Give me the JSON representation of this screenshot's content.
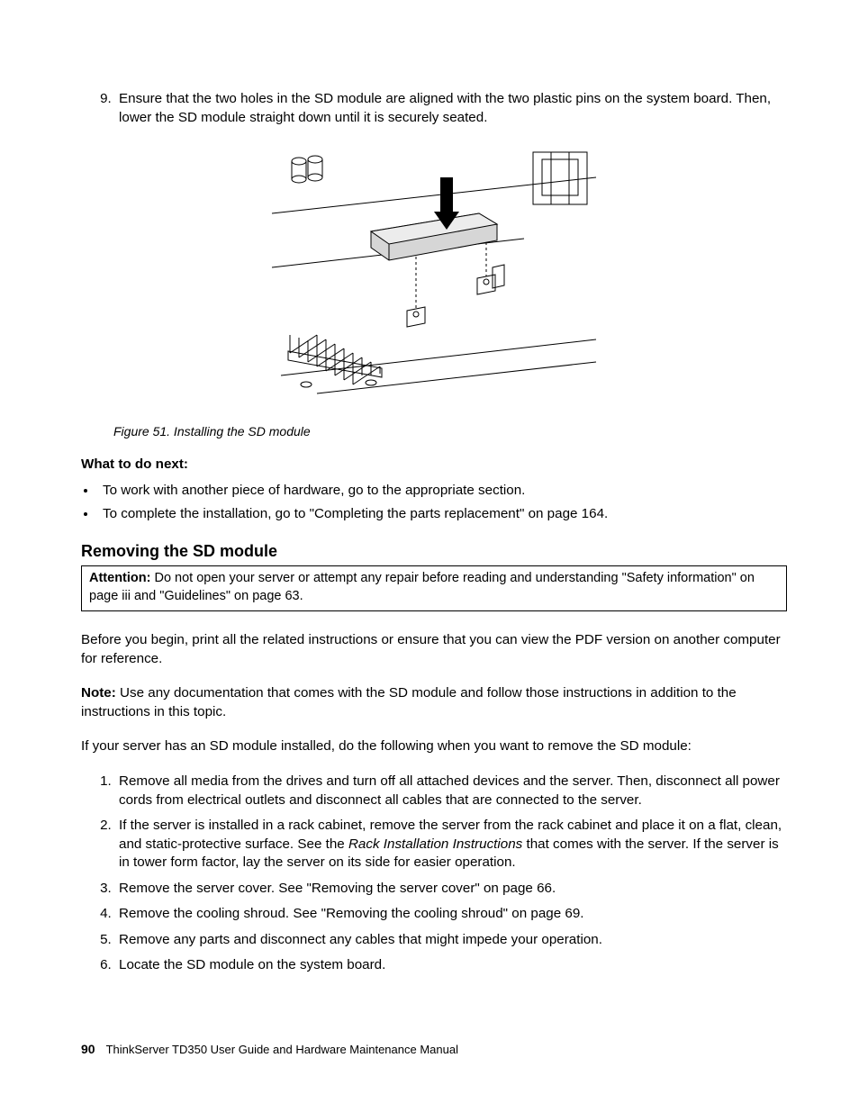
{
  "step9": {
    "number": "9.",
    "text": "Ensure that the two holes in the SD module are aligned with the two plastic pins on the system board. Then, lower the SD module straight down until it is securely seated."
  },
  "figure_caption": "Figure 51.  Installing the SD module",
  "what_next_heading": "What to do next:",
  "what_next_items": [
    "To work with another piece of hardware, go to the appropriate section.",
    "To complete the installation, go to \"Completing the parts replacement\" on page 164."
  ],
  "section_title": "Removing the SD module",
  "attention_label": "Attention:",
  "attention_text": " Do not open your server or attempt any repair before reading and understanding \"Safety information\" on page iii and \"Guidelines\" on page 63.",
  "para_before": "Before you begin, print all the related instructions or ensure that you can view the PDF version on another computer for reference.",
  "note_label": "Note:",
  "note_text": " Use any documentation that comes with the SD module and follow those instructions in addition to the instructions in this topic.",
  "para_if": "If your server has an SD module installed, do the following when you want to remove the SD module:",
  "steps": [
    "Remove all media from the drives and turn off all attached devices and the server. Then, disconnect all power cords from electrical outlets and disconnect all cables that are connected to the server.",
    {
      "pre": "If the server is installed in a rack cabinet, remove the server from the rack cabinet and place it on a flat, clean, and static-protective surface. See the ",
      "italic": "Rack Installation Instructions",
      "post": " that comes with the server. If the server is in tower form factor, lay the server on its side for easier operation."
    },
    "Remove the server cover. See \"Removing the server cover\" on page 66.",
    "Remove the cooling shroud. See \"Removing the cooling shroud\" on page 69.",
    "Remove any parts and disconnect any cables that might impede your operation.",
    "Locate the SD module on the system board."
  ],
  "footer_page": "90",
  "footer_text": "ThinkServer TD350 User Guide and Hardware Maintenance Manual"
}
